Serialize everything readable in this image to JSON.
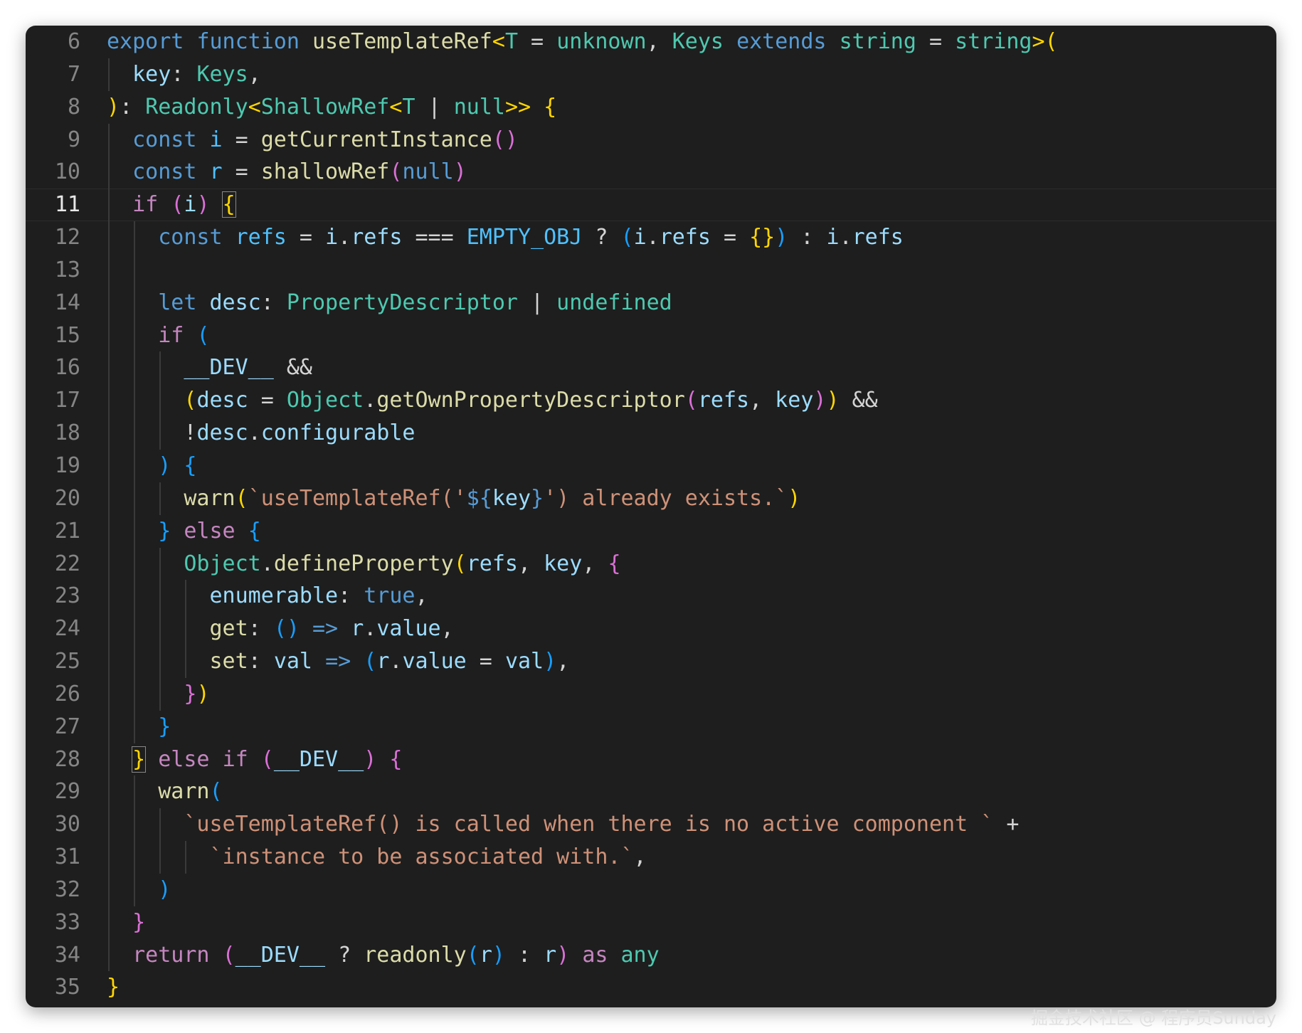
{
  "editor": {
    "language": "TypeScript",
    "current_line": 11,
    "watermark": "掘金技术社区 @ 程序员Sunday"
  },
  "lines": [
    {
      "n": "6",
      "g": [],
      "t": [
        [
          "kw",
          "export"
        ],
        [
          "op",
          " "
        ],
        [
          "kw",
          "function"
        ],
        [
          "op",
          " "
        ],
        [
          "fn",
          "useTemplateRef"
        ],
        [
          "b1",
          "<"
        ],
        [
          "ty",
          "T"
        ],
        [
          "op",
          " = "
        ],
        [
          "ty",
          "unknown"
        ],
        [
          "op",
          ", "
        ],
        [
          "ty",
          "Keys"
        ],
        [
          "op",
          " "
        ],
        [
          "kw",
          "extends"
        ],
        [
          "op",
          " "
        ],
        [
          "ty",
          "string"
        ],
        [
          "op",
          " = "
        ],
        [
          "ty",
          "string"
        ],
        [
          "b1",
          ">("
        ]
      ]
    },
    {
      "n": "7",
      "g": [
        0
      ],
      "t": [
        [
          "op",
          "  "
        ],
        [
          "var",
          "key"
        ],
        [
          "op",
          ": "
        ],
        [
          "ty",
          "Keys"
        ],
        [
          "op",
          ","
        ]
      ]
    },
    {
      "n": "8",
      "g": [],
      "t": [
        [
          "b1",
          ")"
        ],
        [
          "op",
          ": "
        ],
        [
          "ty",
          "Readonly"
        ],
        [
          "b1",
          "<"
        ],
        [
          "ty",
          "ShallowRef"
        ],
        [
          "b1",
          "<"
        ],
        [
          "ty",
          "T"
        ],
        [
          "op",
          " | "
        ],
        [
          "ty",
          "null"
        ],
        [
          "b1",
          ">>"
        ],
        [
          "op",
          " "
        ],
        [
          "b1",
          "{"
        ]
      ]
    },
    {
      "n": "9",
      "g": [
        0
      ],
      "t": [
        [
          "op",
          "  "
        ],
        [
          "kw",
          "const"
        ],
        [
          "op",
          " "
        ],
        [
          "cst",
          "i"
        ],
        [
          "op",
          " = "
        ],
        [
          "fn",
          "getCurrentInstance"
        ],
        [
          "b2",
          "()"
        ]
      ]
    },
    {
      "n": "10",
      "g": [
        0
      ],
      "t": [
        [
          "op",
          "  "
        ],
        [
          "kw",
          "const"
        ],
        [
          "op",
          " "
        ],
        [
          "cst",
          "r"
        ],
        [
          "op",
          " = "
        ],
        [
          "fn",
          "shallowRef"
        ],
        [
          "b2",
          "("
        ],
        [
          "kw",
          "null"
        ],
        [
          "b2",
          ")"
        ]
      ]
    },
    {
      "n": "11",
      "g": [
        0
      ],
      "t": [
        [
          "op",
          "  "
        ],
        [
          "ctl",
          "if"
        ],
        [
          "op",
          " "
        ],
        [
          "b2",
          "("
        ],
        [
          "var",
          "i"
        ],
        [
          "b2",
          ")"
        ],
        [
          "op",
          " "
        ],
        [
          "bm",
          "{"
        ]
      ]
    },
    {
      "n": "12",
      "g": [
        0,
        1
      ],
      "t": [
        [
          "op",
          "    "
        ],
        [
          "kw",
          "const"
        ],
        [
          "op",
          " "
        ],
        [
          "cst",
          "refs"
        ],
        [
          "op",
          " = "
        ],
        [
          "var",
          "i"
        ],
        [
          "op",
          "."
        ],
        [
          "var",
          "refs"
        ],
        [
          "op",
          " === "
        ],
        [
          "cst",
          "EMPTY_OBJ"
        ],
        [
          "op",
          " ? "
        ],
        [
          "b3",
          "("
        ],
        [
          "var",
          "i"
        ],
        [
          "op",
          "."
        ],
        [
          "var",
          "refs"
        ],
        [
          "op",
          " = "
        ],
        [
          "b1",
          "{}"
        ],
        [
          "b3",
          ")"
        ],
        [
          "op",
          " : "
        ],
        [
          "var",
          "i"
        ],
        [
          "op",
          "."
        ],
        [
          "var",
          "refs"
        ]
      ]
    },
    {
      "n": "13",
      "g": [
        0,
        1
      ],
      "t": []
    },
    {
      "n": "14",
      "g": [
        0,
        1
      ],
      "t": [
        [
          "op",
          "    "
        ],
        [
          "kw",
          "let"
        ],
        [
          "op",
          " "
        ],
        [
          "var",
          "desc"
        ],
        [
          "op",
          ": "
        ],
        [
          "ty",
          "PropertyDescriptor"
        ],
        [
          "op",
          " | "
        ],
        [
          "ty",
          "undefined"
        ]
      ]
    },
    {
      "n": "15",
      "g": [
        0,
        1
      ],
      "t": [
        [
          "op",
          "    "
        ],
        [
          "ctl",
          "if"
        ],
        [
          "op",
          " "
        ],
        [
          "b3",
          "("
        ]
      ]
    },
    {
      "n": "16",
      "g": [
        0,
        1,
        2
      ],
      "t": [
        [
          "op",
          "      "
        ],
        [
          "var",
          "__DEV__"
        ],
        [
          "op",
          " &&"
        ]
      ]
    },
    {
      "n": "17",
      "g": [
        0,
        1,
        2
      ],
      "t": [
        [
          "op",
          "      "
        ],
        [
          "b1",
          "("
        ],
        [
          "var",
          "desc"
        ],
        [
          "op",
          " = "
        ],
        [
          "ty",
          "Object"
        ],
        [
          "op",
          "."
        ],
        [
          "fn",
          "getOwnPropertyDescriptor"
        ],
        [
          "b2",
          "("
        ],
        [
          "var",
          "refs"
        ],
        [
          "op",
          ", "
        ],
        [
          "var",
          "key"
        ],
        [
          "b2",
          ")"
        ],
        [
          "b1",
          ")"
        ],
        [
          "op",
          " &&"
        ]
      ]
    },
    {
      "n": "18",
      "g": [
        0,
        1,
        2
      ],
      "t": [
        [
          "op",
          "      !"
        ],
        [
          "var",
          "desc"
        ],
        [
          "op",
          "."
        ],
        [
          "var",
          "configurable"
        ]
      ]
    },
    {
      "n": "19",
      "g": [
        0,
        1
      ],
      "t": [
        [
          "op",
          "    "
        ],
        [
          "b3",
          ")"
        ],
        [
          "op",
          " "
        ],
        [
          "b3",
          "{"
        ]
      ]
    },
    {
      "n": "20",
      "g": [
        0,
        1,
        2
      ],
      "t": [
        [
          "op",
          "      "
        ],
        [
          "fn",
          "warn"
        ],
        [
          "b1",
          "("
        ],
        [
          "str",
          "`useTemplateRef('"
        ],
        [
          "kw",
          "${"
        ],
        [
          "var",
          "key"
        ],
        [
          "kw",
          "}"
        ],
        [
          "str",
          "') already exists.`"
        ],
        [
          "b1",
          ")"
        ]
      ]
    },
    {
      "n": "21",
      "g": [
        0,
        1
      ],
      "t": [
        [
          "op",
          "    "
        ],
        [
          "b3",
          "}"
        ],
        [
          "op",
          " "
        ],
        [
          "ctl",
          "else"
        ],
        [
          "op",
          " "
        ],
        [
          "b3",
          "{"
        ]
      ]
    },
    {
      "n": "22",
      "g": [
        0,
        1,
        2
      ],
      "t": [
        [
          "op",
          "      "
        ],
        [
          "ty",
          "Object"
        ],
        [
          "op",
          "."
        ],
        [
          "fn",
          "defineProperty"
        ],
        [
          "b1",
          "("
        ],
        [
          "var",
          "refs"
        ],
        [
          "op",
          ", "
        ],
        [
          "var",
          "key"
        ],
        [
          "op",
          ", "
        ],
        [
          "b2",
          "{"
        ]
      ]
    },
    {
      "n": "23",
      "g": [
        0,
        1,
        2,
        3
      ],
      "t": [
        [
          "op",
          "        "
        ],
        [
          "var",
          "enumerable"
        ],
        [
          "op",
          ": "
        ],
        [
          "kw",
          "true"
        ],
        [
          "op",
          ","
        ]
      ]
    },
    {
      "n": "24",
      "g": [
        0,
        1,
        2,
        3
      ],
      "t": [
        [
          "op",
          "        "
        ],
        [
          "fn",
          "get"
        ],
        [
          "op",
          ": "
        ],
        [
          "b3",
          "()"
        ],
        [
          "op",
          " "
        ],
        [
          "kw",
          "=>"
        ],
        [
          "op",
          " "
        ],
        [
          "var",
          "r"
        ],
        [
          "op",
          "."
        ],
        [
          "var",
          "value"
        ],
        [
          "op",
          ","
        ]
      ]
    },
    {
      "n": "25",
      "g": [
        0,
        1,
        2,
        3
      ],
      "t": [
        [
          "op",
          "        "
        ],
        [
          "fn",
          "set"
        ],
        [
          "op",
          ": "
        ],
        [
          "var",
          "val"
        ],
        [
          "op",
          " "
        ],
        [
          "kw",
          "=>"
        ],
        [
          "op",
          " "
        ],
        [
          "b3",
          "("
        ],
        [
          "var",
          "r"
        ],
        [
          "op",
          "."
        ],
        [
          "var",
          "value"
        ],
        [
          "op",
          " = "
        ],
        [
          "var",
          "val"
        ],
        [
          "b3",
          ")"
        ],
        [
          "op",
          ","
        ]
      ]
    },
    {
      "n": "26",
      "g": [
        0,
        1,
        2
      ],
      "t": [
        [
          "op",
          "      "
        ],
        [
          "b2",
          "}"
        ],
        [
          "b1",
          ")"
        ]
      ]
    },
    {
      "n": "27",
      "g": [
        0,
        1
      ],
      "t": [
        [
          "op",
          "    "
        ],
        [
          "b3",
          "}"
        ]
      ]
    },
    {
      "n": "28",
      "g": [
        0
      ],
      "t": [
        [
          "op",
          "  "
        ],
        [
          "bm",
          "}"
        ],
        [
          "op",
          " "
        ],
        [
          "ctl",
          "else"
        ],
        [
          "op",
          " "
        ],
        [
          "ctl",
          "if"
        ],
        [
          "op",
          " "
        ],
        [
          "b2",
          "("
        ],
        [
          "var",
          "__DEV__"
        ],
        [
          "b2",
          ")"
        ],
        [
          "op",
          " "
        ],
        [
          "b2",
          "{"
        ]
      ]
    },
    {
      "n": "29",
      "g": [
        0,
        1
      ],
      "t": [
        [
          "op",
          "    "
        ],
        [
          "fn",
          "warn"
        ],
        [
          "b3",
          "("
        ]
      ]
    },
    {
      "n": "30",
      "g": [
        0,
        1,
        2
      ],
      "t": [
        [
          "op",
          "      "
        ],
        [
          "str",
          "`useTemplateRef() is called when there is no active component `"
        ],
        [
          "op",
          " +"
        ]
      ]
    },
    {
      "n": "31",
      "g": [
        0,
        1,
        2,
        3
      ],
      "t": [
        [
          "op",
          "        "
        ],
        [
          "str",
          "`instance to be associated with.`"
        ],
        [
          "op",
          ","
        ]
      ]
    },
    {
      "n": "32",
      "g": [
        0,
        1
      ],
      "t": [
        [
          "op",
          "    "
        ],
        [
          "b3",
          ")"
        ]
      ]
    },
    {
      "n": "33",
      "g": [
        0
      ],
      "t": [
        [
          "op",
          "  "
        ],
        [
          "b2",
          "}"
        ]
      ]
    },
    {
      "n": "34",
      "g": [
        0
      ],
      "t": [
        [
          "op",
          "  "
        ],
        [
          "ctl",
          "return"
        ],
        [
          "op",
          " "
        ],
        [
          "b2",
          "("
        ],
        [
          "var",
          "__DEV__"
        ],
        [
          "op",
          " ? "
        ],
        [
          "fn",
          "readonly"
        ],
        [
          "b3",
          "("
        ],
        [
          "var",
          "r"
        ],
        [
          "b3",
          ")"
        ],
        [
          "op",
          " : "
        ],
        [
          "var",
          "r"
        ],
        [
          "b2",
          ")"
        ],
        [
          "op",
          " "
        ],
        [
          "ctl",
          "as"
        ],
        [
          "op",
          " "
        ],
        [
          "ty",
          "any"
        ]
      ]
    },
    {
      "n": "35",
      "g": [],
      "t": [
        [
          "b1",
          "}"
        ]
      ]
    }
  ]
}
